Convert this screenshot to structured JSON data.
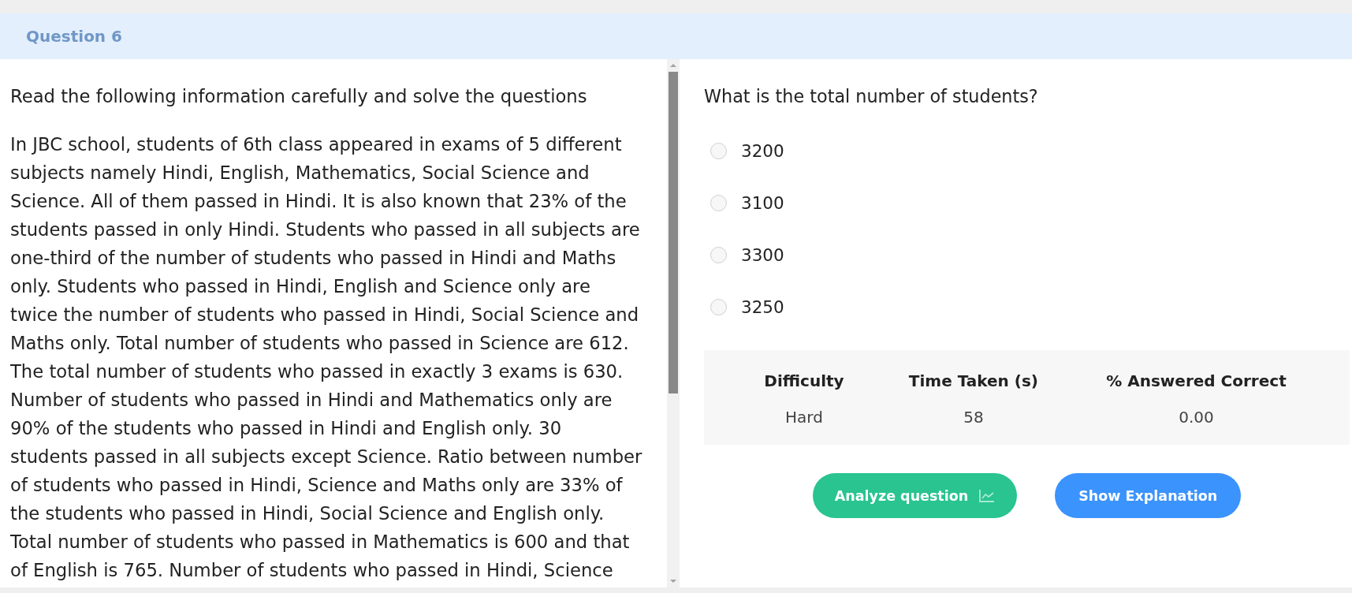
{
  "header": {
    "title": "Question 6"
  },
  "passage": {
    "instruction": "Read the following information carefully and solve the questions",
    "text": "In JBC school, students of 6th class appeared in exams of 5 different subjects namely Hindi, English, Mathematics, Social Science and Science. All of them passed in Hindi. It is also known that 23% of the students passed in only Hindi. Students who passed in all subjects are one-third of the number of students who passed in Hindi and Maths only. Students who passed in Hindi, English and Science only are twice the number of students who passed in Hindi, Social Science and Maths only. Total number of students who passed in Science are 612. The total number of students who passed in exactly 3 exams is 630. Number of students who passed in Hindi and Mathematics only are 90% of the students who passed in Hindi and English only. 30 students passed in all subjects except Science. Ratio between number of students who passed in Hindi, Science and Maths only are 33% of the students who passed in Hindi, Social Science and English only. Total number of students who passed in Mathematics is 600 and that of English is 765. Number of students who passed in Hindi, Science"
  },
  "question": {
    "prompt": "What is the total number of students?",
    "options": [
      {
        "label": "3200",
        "selected": false
      },
      {
        "label": "3100",
        "selected": false
      },
      {
        "label": "3300",
        "selected": false
      },
      {
        "label": "3250",
        "selected": false
      }
    ]
  },
  "stats": {
    "columns": [
      "Difficulty",
      "Time Taken (s)",
      "% Answered Correct"
    ],
    "values": [
      "Hard",
      "58",
      "0.00"
    ]
  },
  "buttons": [
    {
      "label": "Analyze question",
      "kind": "analyze"
    },
    {
      "label": "Show Explanation",
      "kind": "explanation"
    }
  ]
}
